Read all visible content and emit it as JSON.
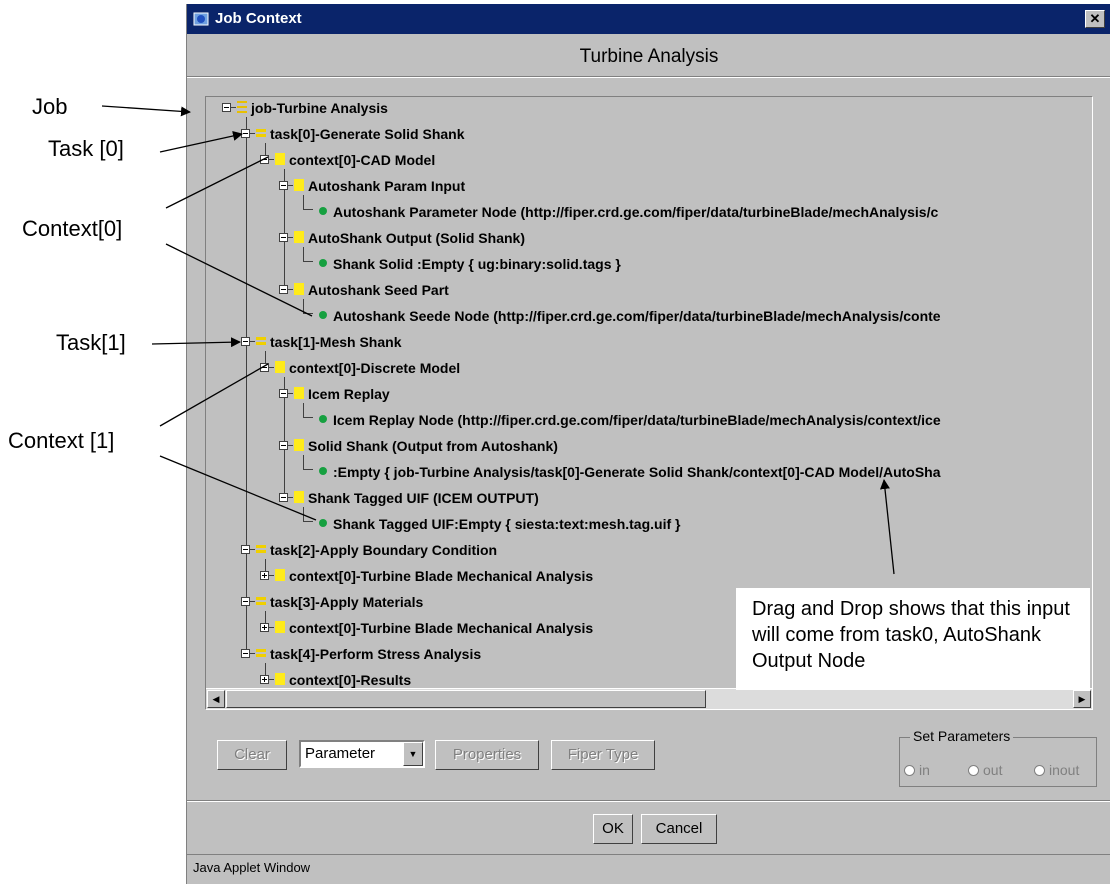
{
  "window": {
    "title": "Job Context",
    "close_glyph": "✕",
    "heading": "Turbine  Analysis",
    "status_bar": "Java Applet Window"
  },
  "tree": {
    "job": "job-Turbine  Analysis",
    "task0": "task[0]-Generate Solid Shank",
    "task0_context": "context[0]-CAD Model",
    "autoshank_param_input": "Autoshank Param Input",
    "autoshank_param_node": "Autoshank Parameter  Node (http://fiper.crd.ge.com/fiper/data/turbineBlade/mechAnalysis/c",
    "autoshank_output": "AutoShank Output (Solid Shank)",
    "shank_solid": "Shank Solid :Empty { ug:binary:solid.tags }",
    "autoshank_seed_part": "Autoshank Seed Part",
    "autoshank_seede_node": "Autoshank Seede Node (http://fiper.crd.ge.com/fiper/data/turbineBlade/mechAnalysis/conte",
    "task1": "task[1]-Mesh Shank",
    "task1_context": "context[0]-Discrete Model",
    "icem_replay": "Icem Replay",
    "icem_replay_node": "Icem Replay Node (http://fiper.crd.ge.com/fiper/data/turbineBlade/mechAnalysis/context/ice",
    "solid_shank_output": "Solid Shank (Output from Autoshank)",
    "empty_ref": ":Empty { job-Turbine  Analysis/task[0]-Generate Solid Shank/context[0]-CAD Model/AutoSha",
    "shank_tagged_uif": "Shank Tagged UIF (ICEM OUTPUT)",
    "shank_tagged_uif_node": "Shank Tagged UIF:Empty { siesta:text:mesh.tag.uif }",
    "task2": "task[2]-Apply Boundary Condition",
    "task2_context": "context[0]-Turbine Blade Mechanical Analysis",
    "task3": "task[3]-Apply Materials",
    "task3_context": "context[0]-Turbine Blade Mechanical Analysis",
    "task4": "task[4]-Perform Stress Analysis",
    "task4_context": "context[0]-Results"
  },
  "scrollbar": {
    "left_glyph": "◀",
    "right_glyph": "▶",
    "position_fraction": 0.0
  },
  "toolbar": {
    "clear": "Clear",
    "parameter_select": "Parameter",
    "dropdown_glyph": "▼",
    "properties": "Properties",
    "fiper_type": "Fiper Type",
    "set_parameters_legend": "Set Parameters",
    "radio_in": "in",
    "radio_out": "out",
    "radio_inout": "inout"
  },
  "dialog_buttons": {
    "ok": "OK",
    "cancel": "Cancel"
  },
  "annotations": {
    "job": "Job",
    "task0": "Task [0]",
    "context0": "Context[0]",
    "task1": "Task[1]",
    "context1": "Context [1]",
    "note": "Drag and Drop shows that this input will come from task0, AutoShank Output Node"
  },
  "colors": {
    "titlebar": "#0a246a",
    "dialog_background": "#c0c0c0",
    "task_icon": "#f0d000",
    "context_icon": "#ffeb1a",
    "node_icon": "#16a040"
  },
  "icons": [
    "applet-icon",
    "close-icon",
    "expand-toggle-icon",
    "job-icon",
    "task-icon",
    "context-icon",
    "node-icon",
    "dropdown-arrow-icon",
    "scroll-left-icon",
    "scroll-right-icon"
  ]
}
